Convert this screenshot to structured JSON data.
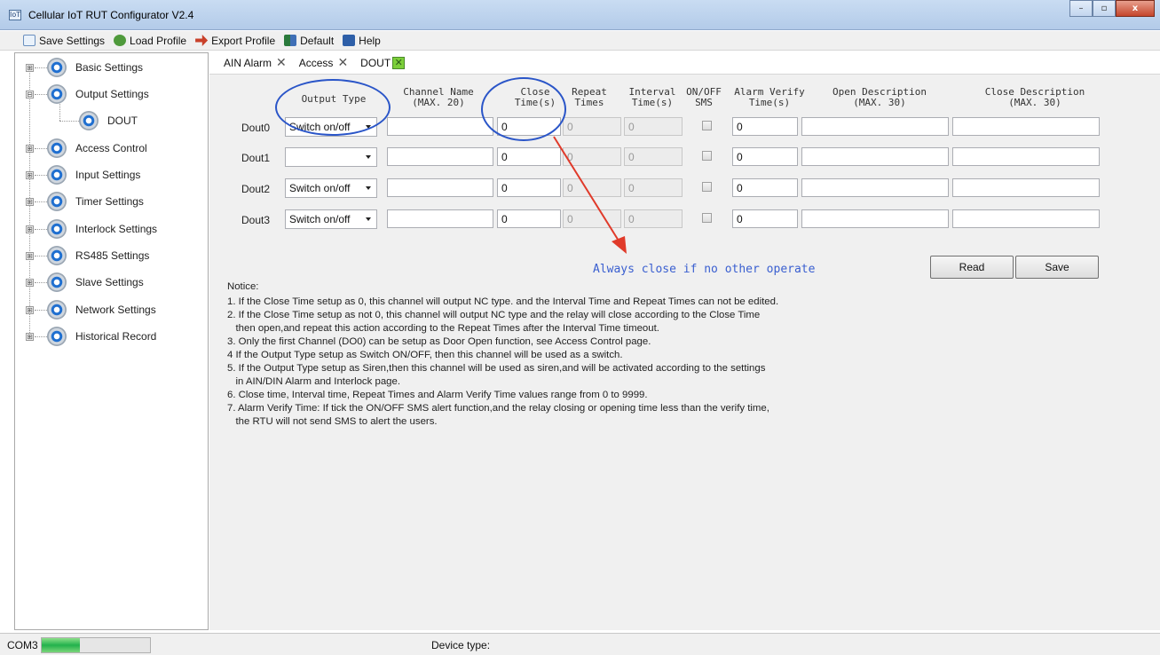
{
  "window": {
    "title": "Cellular IoT RUT Configurator V2.4",
    "app_icon": "IoT"
  },
  "window_controls": {
    "minimize": "–",
    "maximize": "▫",
    "close": "x"
  },
  "toolbar": {
    "save_settings": "Save Settings",
    "load_profile": "Load Profile",
    "export_profile": "Export Profile",
    "default": "Default",
    "help": "Help"
  },
  "sidebar": {
    "items": [
      {
        "label": "Basic Settings"
      },
      {
        "label": "Output Settings"
      },
      {
        "label": "DOUT"
      },
      {
        "label": "Access Control"
      },
      {
        "label": "Input Settings"
      },
      {
        "label": "Timer Settings"
      },
      {
        "label": "Interlock Settings"
      },
      {
        "label": "RS485 Settings"
      },
      {
        "label": "Slave Settings"
      },
      {
        "label": "Network Settings"
      },
      {
        "label": "Historical Record"
      }
    ],
    "expander": "⊞",
    "collapser": "⊟"
  },
  "tabs": [
    {
      "label": "AIN Alarm",
      "close": "✕"
    },
    {
      "label": "Access",
      "close": "✕"
    },
    {
      "label": "DOUT",
      "close": "✕",
      "active": true
    }
  ],
  "headers": {
    "output_type": "Output Type",
    "channel_name": "Channel Name\n(MAX. 20)",
    "close_time": "Close\nTime(s)",
    "repeat_times": "Repeat\nTimes",
    "interval_time": "Interval\nTime(s)",
    "onoff_sms": "ON/OFF\nSMS",
    "alarm_verify": "Alarm Verify\nTime(s)",
    "open_desc": "Open Description\n(MAX. 30)",
    "close_desc": "Close Description\n(MAX. 30)"
  },
  "rows": [
    {
      "label": "Dout0",
      "output_type": "Switch on/off",
      "channel_name": "",
      "close_time": "0",
      "repeat_times": "0",
      "interval_time": "0",
      "sms": false,
      "alarm_verify": "0",
      "open_desc": "",
      "close_desc": ""
    },
    {
      "label": "Dout1",
      "output_type": "",
      "channel_name": "",
      "close_time": "0",
      "repeat_times": "0",
      "interval_time": "0",
      "sms": false,
      "alarm_verify": "0",
      "open_desc": "",
      "close_desc": ""
    },
    {
      "label": "Dout2",
      "output_type": "Switch on/off",
      "channel_name": "",
      "close_time": "0",
      "repeat_times": "0",
      "interval_time": "0",
      "sms": false,
      "alarm_verify": "0",
      "open_desc": "",
      "close_desc": ""
    },
    {
      "label": "Dout3",
      "output_type": "Switch on/off",
      "channel_name": "",
      "close_time": "0",
      "repeat_times": "0",
      "interval_time": "0",
      "sms": false,
      "alarm_verify": "0",
      "open_desc": "",
      "close_desc": ""
    }
  ],
  "annotation": {
    "text": "Always close if no other operate",
    "color": "#3a5fd0",
    "circle_color": "#2a55c8",
    "arrow_color": "#e03a2a"
  },
  "buttons": {
    "read": "Read",
    "save": "Save"
  },
  "notice": {
    "title": "Notice:",
    "lines": [
      "1. If the Close Time setup as 0, this channel will output NC type. and the Interval Time and Repeat Times can not be edited.",
      "2. If the Close Time setup as not 0, this channel will output NC type and the relay will close according to the Close Time",
      "   then open,and repeat this action according to the Repeat Times after the Interval Time timeout.",
      "3. Only the first Channel (DO0) can be setup as Door Open function, see Access Control page.",
      "4  If the Output Type setup as Switch ON/OFF, then this channel will be used as a switch.",
      "5. If the Output Type setup as Siren,then this channel will be used as siren,and will be activated according to the settings",
      "   in AIN/DIN Alarm and Interlock page.",
      "6. Close time, Interval time, Repeat Times and Alarm Verify Time values range from 0 to 9999.",
      "7. Alarm Verify Time: If tick the ON/OFF SMS alert function,and the relay closing or opening time less than the verify time,",
      "   the RTU will not send SMS to alert the users."
    ]
  },
  "status": {
    "port": "COM3",
    "progress": 0.35,
    "device_type": "Device type:"
  }
}
